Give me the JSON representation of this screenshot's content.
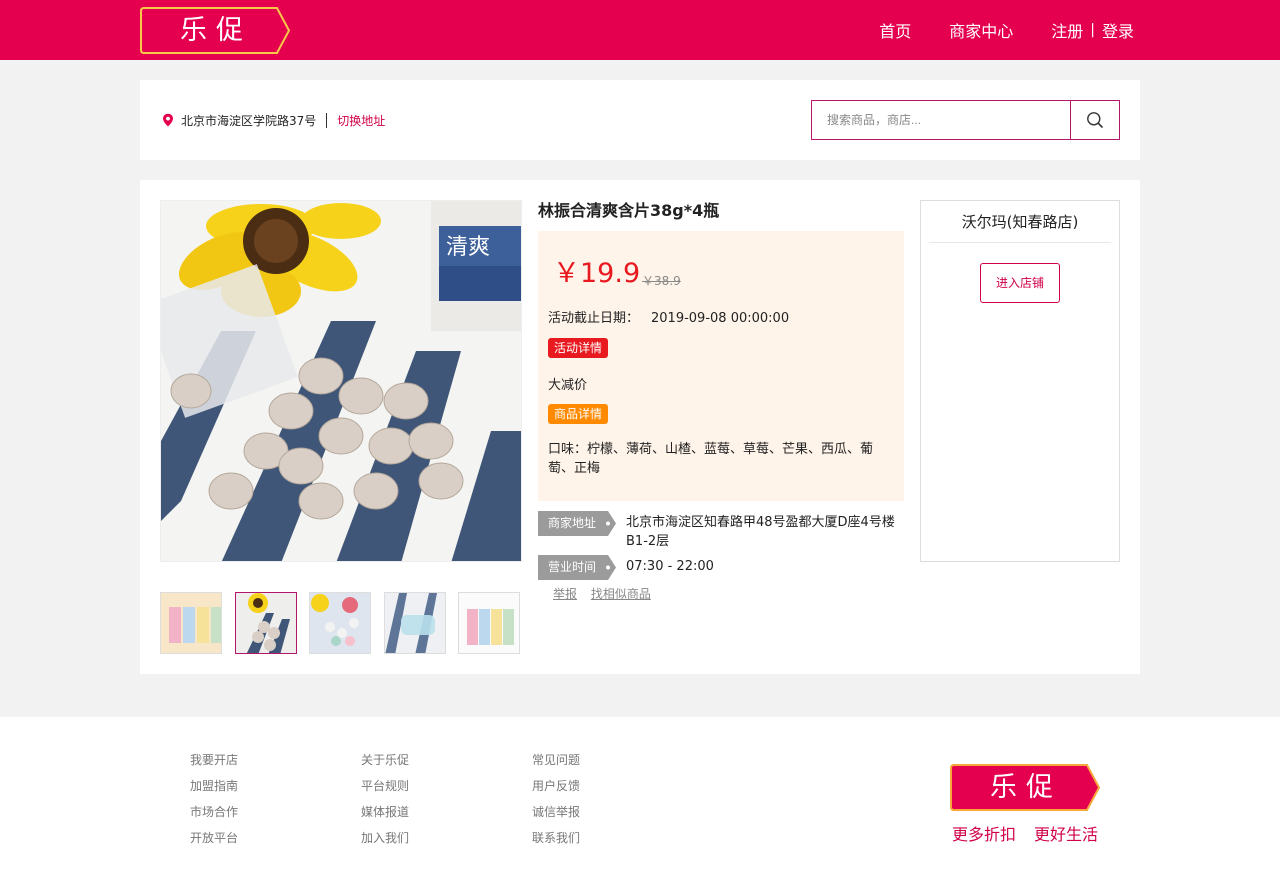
{
  "header": {
    "logo_text": "乐促",
    "nav": {
      "home": "首页",
      "merchant": "商家中心",
      "register": "注册",
      "separator": "|",
      "login": "登录"
    }
  },
  "location": {
    "address": "北京市海淀区学院路37号",
    "switch_label": "切换地址"
  },
  "search": {
    "placeholder": "搜索商品，商店..."
  },
  "product": {
    "title": "林振合清爽含片38g*4瓶",
    "price": "￥19.9",
    "old_price": "￥38.9",
    "deadline_label": "活动截止日期：",
    "deadline_value": "2019-09-08 00:00:00",
    "activity_tag": "活动详情",
    "promotion": "大减价",
    "detail_tag": "商品详情",
    "description": "口味：柠檬、薄荷、山楂、蓝莓、草莓、芒果、西瓜、葡萄、正梅",
    "address_label": "商家地址",
    "address_value": "北京市海淀区知春路甲48号盈都大厦D座4号楼B1-2层",
    "hours_label": "营业时间",
    "hours_value": "07:30 - 22:00",
    "report_link": "举报",
    "similar_link": "找相似商品"
  },
  "shop": {
    "name": "沃尔玛(知春路店)",
    "enter_label": "进入店铺"
  },
  "footer": {
    "col1": [
      "我要开店",
      "加盟指南",
      "市场合作",
      "开放平台"
    ],
    "col2": [
      "关于乐促",
      "平台规则",
      "媒体报道",
      "加入我们"
    ],
    "col3": [
      "常见问题",
      "用户反馈",
      "诚信举报",
      "联系我们"
    ],
    "logo_text": "乐促",
    "slogan1": "更多折扣",
    "slogan2": "更好生活"
  },
  "colors": {
    "brand": "#e4004f",
    "price": "#e8191f",
    "accent": "#b3166a",
    "orange": "#ff8a00"
  }
}
